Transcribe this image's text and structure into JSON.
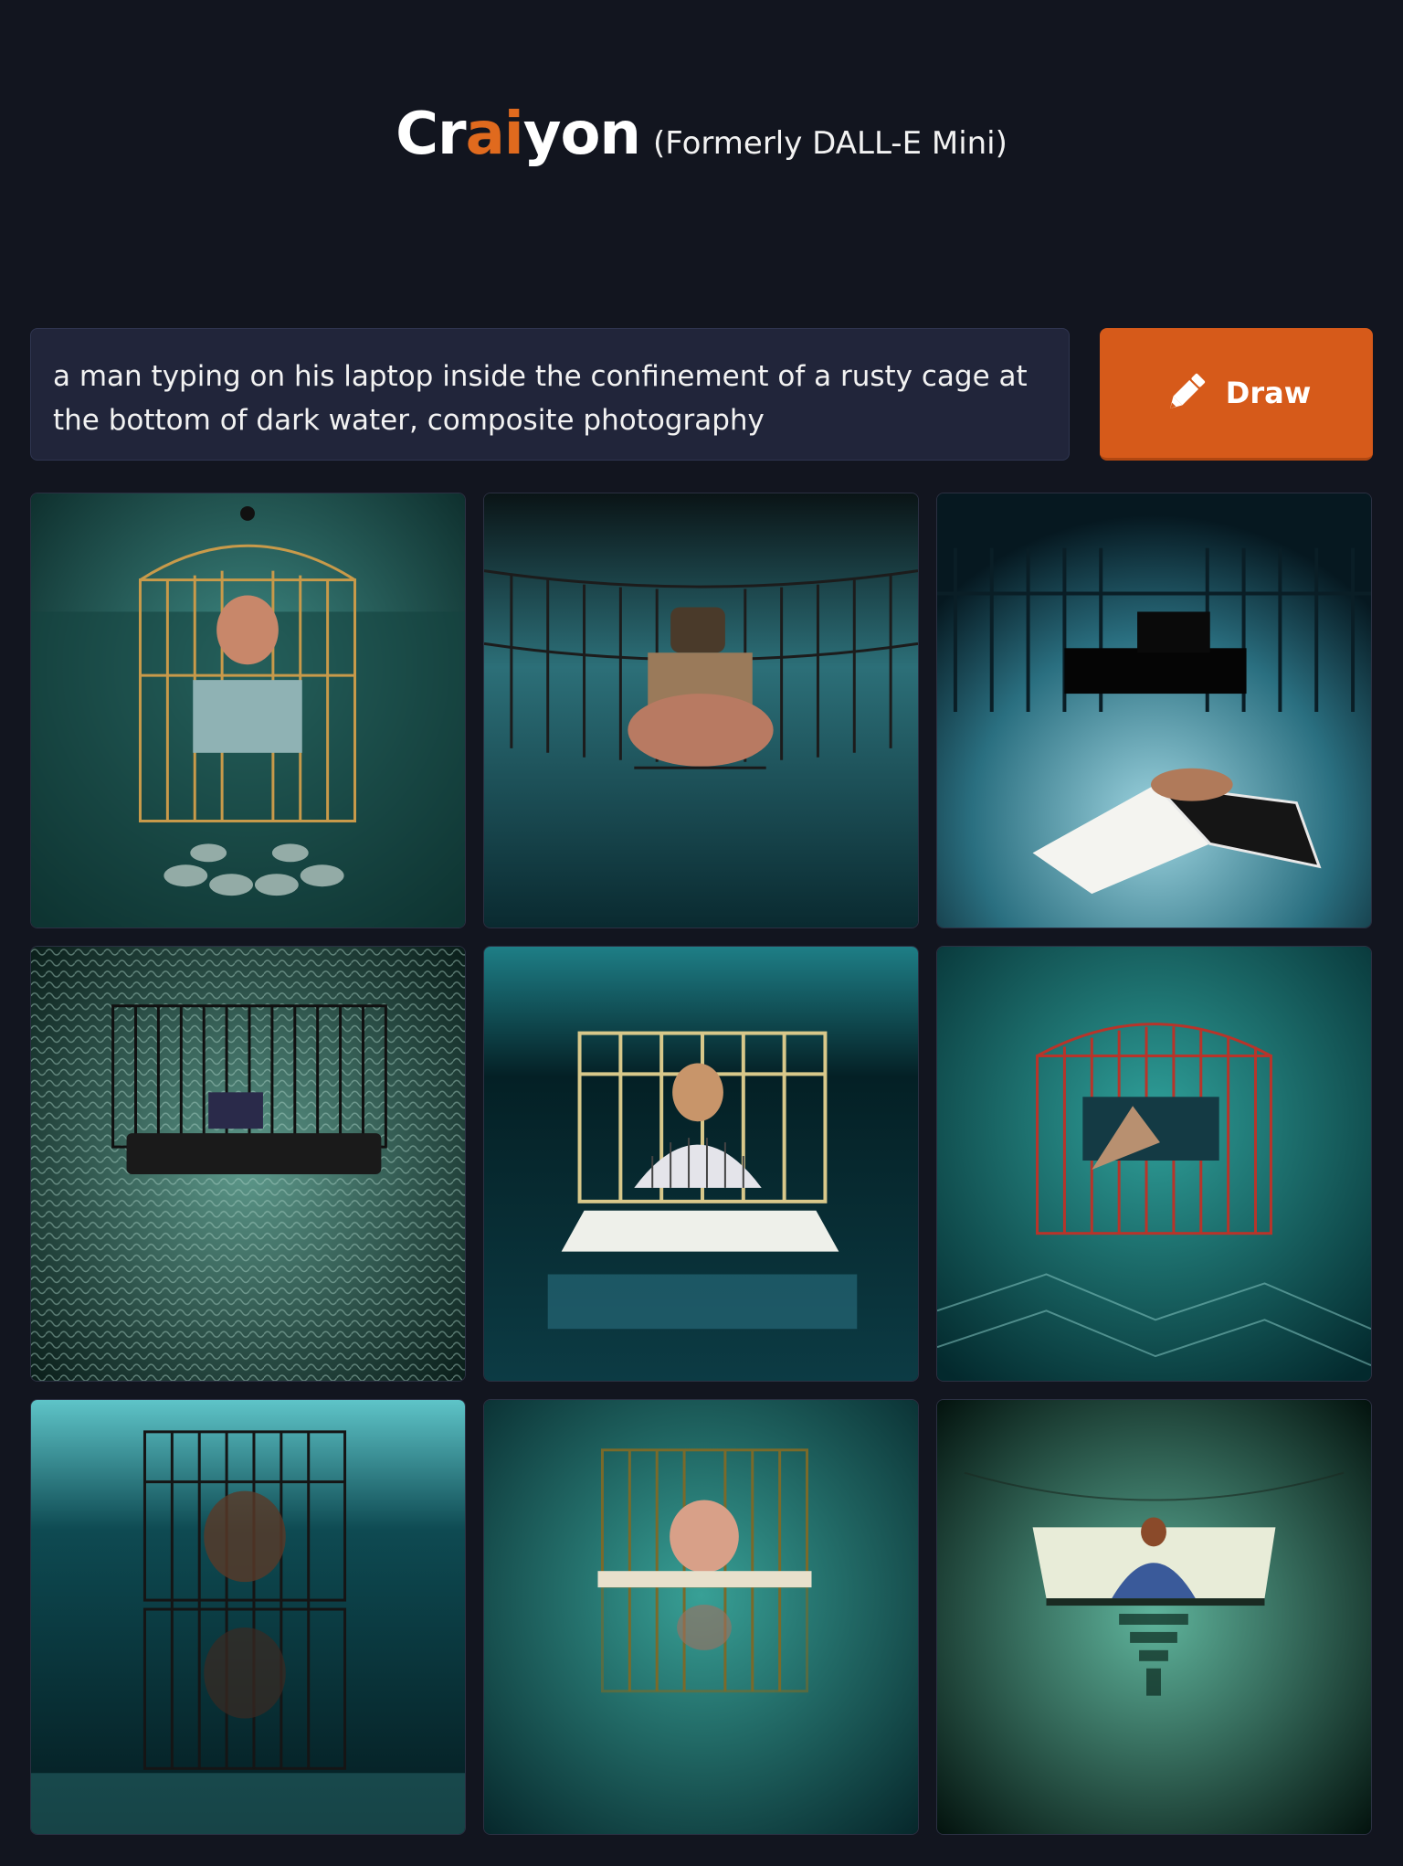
{
  "header": {
    "brand_prefix": "Cr",
    "brand_accent": "ai",
    "brand_suffix": "yon",
    "subtitle": "(Formerly DALL-E Mini)"
  },
  "prompt": {
    "text": "a man typing on his laptop inside the confinement of a rusty cage at the bottom of dark water, composite photography"
  },
  "draw_button": {
    "label": "Draw",
    "icon": "pencil-icon"
  },
  "colors": {
    "background": "#12151f",
    "accent": "#e06a1e",
    "button": "#d65a1a",
    "prompt_bg": "#21253a"
  },
  "gallery": {
    "images": [
      {
        "subject": "gold birdcage with man at laptop on water",
        "palette": [
          "#0b2e2c",
          "#3f8a84",
          "#c89a4a"
        ]
      },
      {
        "subject": "wide metal cage with figure in dark water",
        "palette": [
          "#061a1e",
          "#2c6f78",
          "#9a8a70"
        ]
      },
      {
        "subject": "dark cage with floating laptop",
        "palette": [
          "#081f2a",
          "#4a97a6",
          "#f2f2f2"
        ]
      },
      {
        "subject": "black birdcage over rippled water",
        "palette": [
          "#0c2622",
          "#4f8a7d",
          "#202020"
        ]
      },
      {
        "subject": "yellow cage with person at white laptop",
        "palette": [
          "#052327",
          "#1e7e86",
          "#d8c88a"
        ]
      },
      {
        "subject": "red cage submerged in teal water",
        "palette": [
          "#053f42",
          "#1f8c8a",
          "#b8342a"
        ]
      },
      {
        "subject": "tall cage underwater with reflection",
        "palette": [
          "#031c20",
          "#2c8c90",
          "#1a1a1a"
        ]
      },
      {
        "subject": "small cage with face in water",
        "palette": [
          "#0a3638",
          "#2b8a82",
          "#c8a070"
        ]
      },
      {
        "subject": "man at glowing laptop in green water",
        "palette": [
          "#061814",
          "#3a9a80",
          "#e8ecd8"
        ]
      }
    ]
  }
}
